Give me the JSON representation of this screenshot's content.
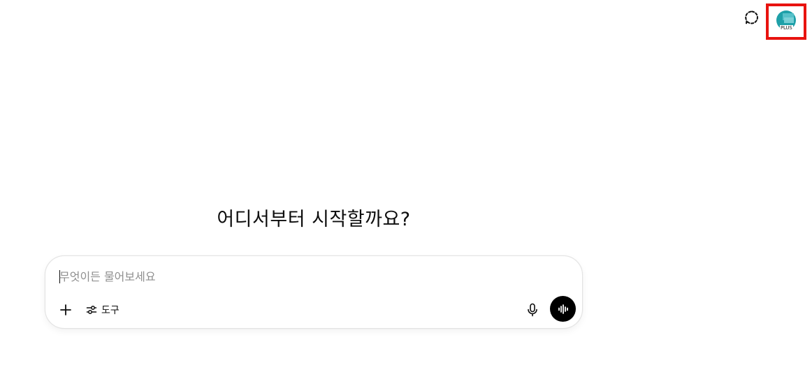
{
  "header": {
    "temporary_chat_icon": "dashed-chat-bubble-icon",
    "avatar_icon": "profile-avatar",
    "plan_badge": "PLUS",
    "highlight_color": "#e8130f"
  },
  "main": {
    "greeting": "어디서부터 시작할까요?"
  },
  "composer": {
    "placeholder": "무엇이든 물어보세요",
    "value": "",
    "attach_icon": "plus-icon",
    "tools_icon": "sliders-icon",
    "tools_label": "도구",
    "mic_icon": "microphone-icon",
    "voice_icon": "voice-waveform-icon"
  }
}
